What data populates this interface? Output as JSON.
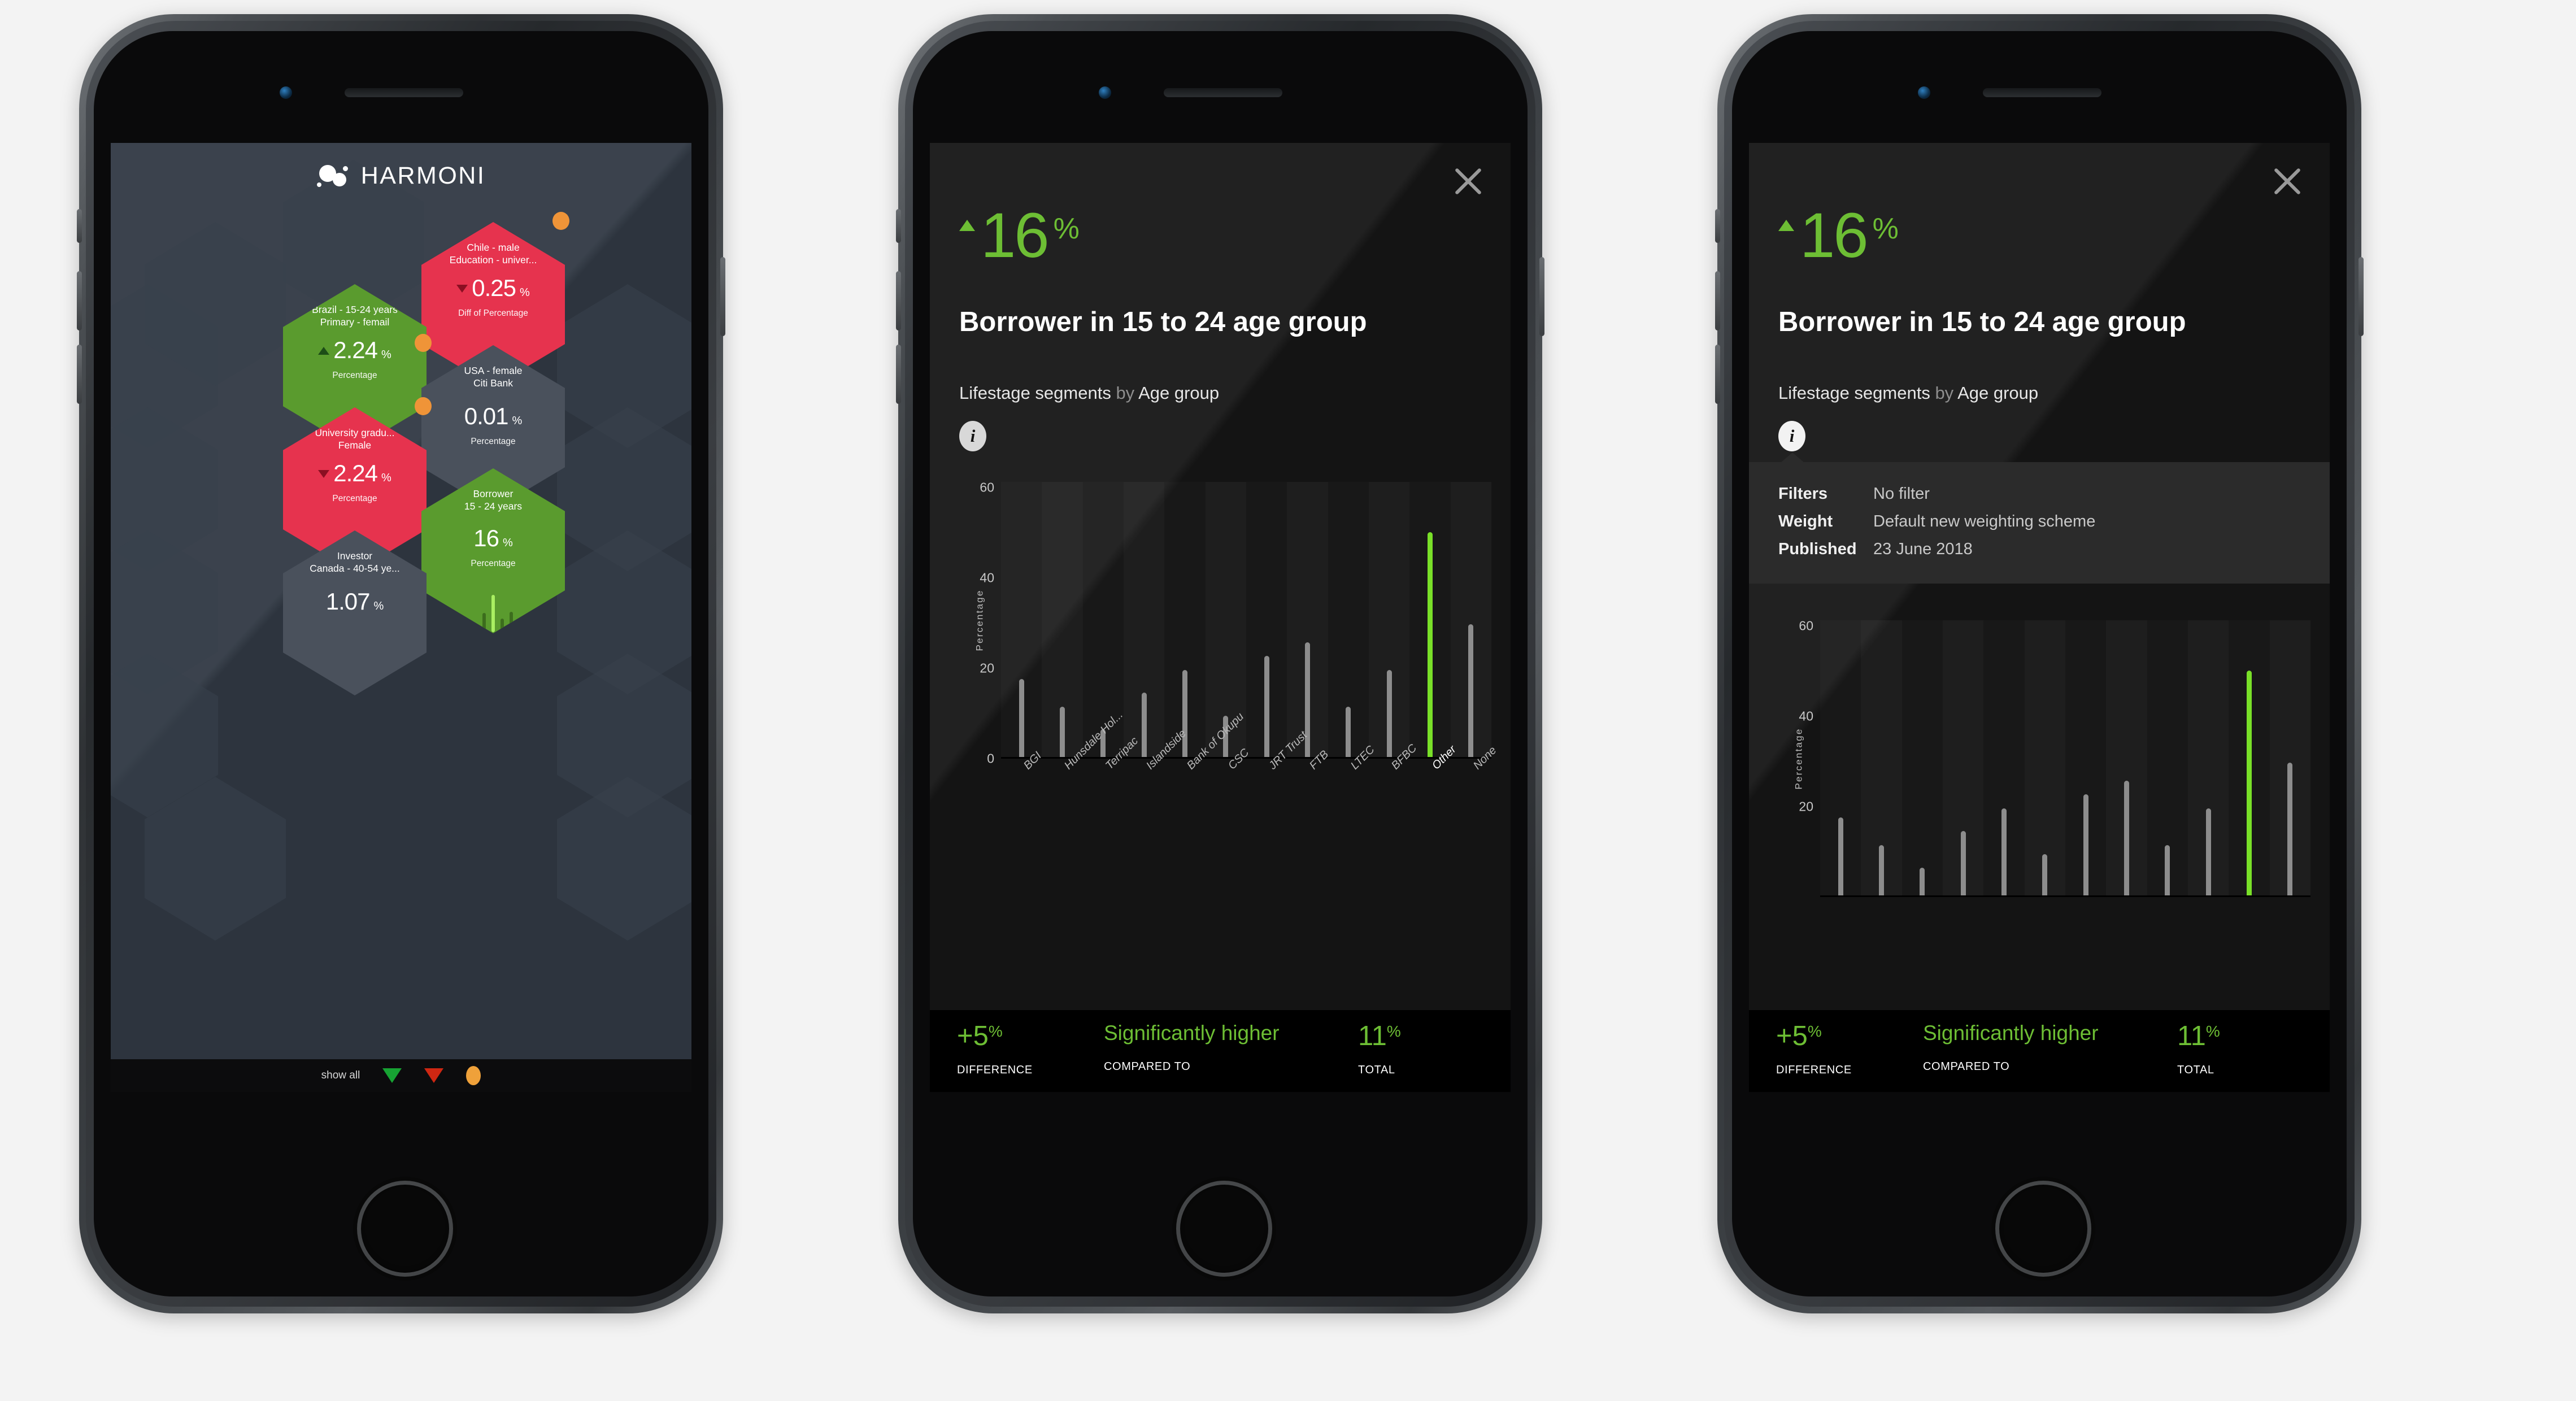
{
  "app": {
    "brand_name": "HARMONI"
  },
  "dashboard": {
    "show_all_label": "show all",
    "legend": {
      "up_icon": "triangle-down-green",
      "down_icon": "triangle-down-red",
      "flag_icon": "orange-dot"
    },
    "tiles": [
      {
        "title_line1": "Chile - male",
        "title_line2": "Education - univer...",
        "value": "0.25",
        "unit": "%",
        "caption": "Diff of Percentage",
        "direction": "down",
        "color": "red",
        "flag": true
      },
      {
        "title_line1": "Brazil - 15-24 years",
        "title_line2": "Primary - femail",
        "value": "2.24",
        "unit": "%",
        "caption": "Percentage",
        "direction": "up",
        "color": "green",
        "flag": true
      },
      {
        "title_line1": "USA - female",
        "title_line2": "Citi Bank",
        "value": "0.01",
        "unit": "%",
        "caption": "Percentage",
        "direction": "none",
        "color": "grey",
        "flag": false
      },
      {
        "title_line1": "University gradu...",
        "title_line2": "Female",
        "value": "2.24",
        "unit": "%",
        "caption": "Percentage",
        "direction": "down",
        "color": "red",
        "flag": true
      },
      {
        "title_line1": "Borrower",
        "title_line2": "15 - 24 years",
        "value": "16",
        "unit": "%",
        "caption": "Percentage",
        "direction": "none",
        "color": "green",
        "flag": false
      },
      {
        "title_line1": "Investor",
        "title_line2": "Canada - 40-54 ye...",
        "value": "1.07",
        "unit": "%",
        "caption": "Percentage",
        "direction": "none",
        "color": "grey",
        "flag": false
      }
    ]
  },
  "detail": {
    "close_icon": "close-x-icon",
    "info_icon": "info-icon",
    "headline_trend": "up",
    "headline_value": "16",
    "headline_unit": "%",
    "title": "Borrower in 15 to 24 age group",
    "subtitle_primary": "Lifestage segments",
    "subtitle_conn": " by ",
    "subtitle_secondary": "Age group",
    "info": {
      "rows": [
        {
          "key": "Filters",
          "value": "No filter"
        },
        {
          "key": "Weight",
          "value": "Default new weighting scheme"
        },
        {
          "key": "Published",
          "value": "23 June 2018"
        }
      ]
    },
    "stats": [
      {
        "value": "+5",
        "unit": "%",
        "key": "DIFFERENCE"
      },
      {
        "phrase": "Significantly higher",
        "key": "COMPARED TO"
      },
      {
        "value": "11",
        "unit": "%",
        "key": "TOTAL"
      }
    ]
  },
  "chart_data": {
    "type": "bar",
    "title": "",
    "xlabel": "",
    "ylabel": "Percentage",
    "ylim": [
      0,
      60
    ],
    "yticks": [
      0,
      20,
      40,
      60
    ],
    "grid": false,
    "legend": "none",
    "highlight_category": "Other",
    "highlight_color": "#79e028",
    "bar_color": "#8d8d8d",
    "categories": [
      "BGI",
      "Hunsdale Hol...",
      "Terripac",
      "Islandside",
      "Bank of Okupu",
      "CSC",
      "JRT Trust",
      "FTB",
      "LTEC",
      "BFBC",
      "Other",
      "None"
    ],
    "values": [
      17,
      11,
      6,
      14,
      19,
      9,
      22,
      25,
      11,
      19,
      49,
      29
    ]
  },
  "colors": {
    "red": "#e6334e",
    "green": "#5a9b2e",
    "grey": "#4a515c",
    "accent_green": "#6dbe34",
    "orange": "#ef9438",
    "dash_bg": "#323a45",
    "detail_bg": "#141414"
  }
}
